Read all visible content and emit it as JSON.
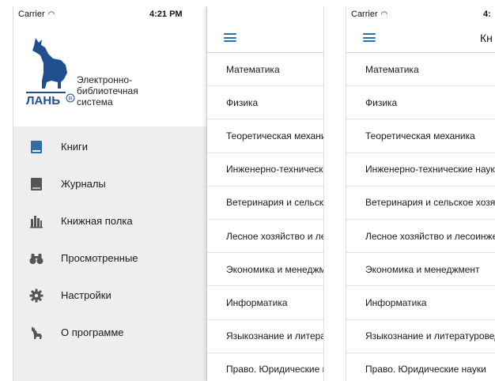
{
  "status": {
    "carrier": "Carrier",
    "time": "4:21 PM",
    "time_partial": "4:"
  },
  "drawer": {
    "logo_text": "ЛАНЬ",
    "title_lines": [
      "Электронно-",
      "библиотечная",
      "система"
    ],
    "items": [
      {
        "label": "Книги",
        "icon": "book-icon"
      },
      {
        "label": "Журналы",
        "icon": "journal-icon"
      },
      {
        "label": "Книжная полка",
        "icon": "bookshelf-icon"
      },
      {
        "label": "Просмотренные",
        "icon": "binoculars-icon"
      },
      {
        "label": "Настройки",
        "icon": "gear-icon"
      },
      {
        "label": "О программе",
        "icon": "deer-icon"
      }
    ]
  },
  "main": {
    "title_partial": "Кн"
  },
  "categories": [
    "Математика",
    "Физика",
    "Теоретическая механика",
    "Инженерно-технические науки",
    "Ветеринария и сельское хозяйство",
    "Лесное хозяйство и лесоинженерное дело",
    "Экономика и менеджмент",
    "Информатика",
    "Языкознание и литературоведение",
    "Право. Юридические науки"
  ],
  "colors": {
    "accent": "#2f6ea6",
    "logo_blue": "#1f4f8f",
    "drawer_bg": "#eeeeee"
  }
}
